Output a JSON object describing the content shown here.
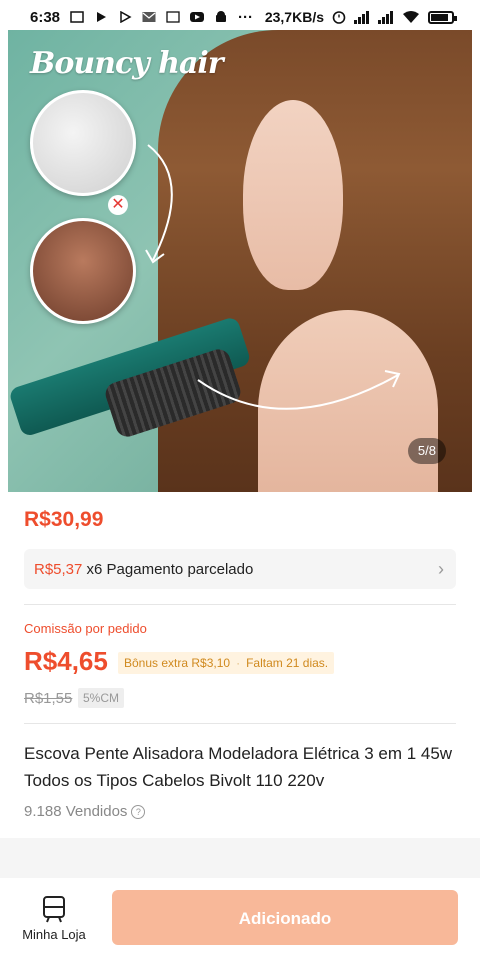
{
  "status_bar": {
    "time": "6:38",
    "speed": "23,7KB/s",
    "dots": "···"
  },
  "gallery": {
    "brand": "Bouncy hair",
    "page_indicator": "5/8"
  },
  "product": {
    "price": "R$30,99",
    "installment_amount": "R$5,37",
    "installment_text": "x6 Pagamento parcelado",
    "commission_label": "Comissão por pedido",
    "commission_value": "R$4,65",
    "bonus_text": "Bônus extra R$3,10",
    "bonus_deadline": "Faltam 21 dias.",
    "old_commission": "R$1,55",
    "cm_badge": "5%CM",
    "title": "Escova Pente Alisadora Modeladora Elétrica 3 em 1 45w Todos os Tipos Cabelos Bivolt 110 220v",
    "sold": "9.188 Vendidos"
  },
  "bottom_bar": {
    "store_label": "Minha Loja",
    "add_button_label": "Adicionado"
  },
  "colors": {
    "accent": "#ee4d2d",
    "button_disabled": "#f8b899",
    "bonus_text": "#d08a1f"
  },
  "icons": {
    "store": "store-icon",
    "chevron": "chevron-right-icon",
    "help": "help-icon",
    "wifi": "wifi-icon",
    "battery": "battery-icon"
  }
}
